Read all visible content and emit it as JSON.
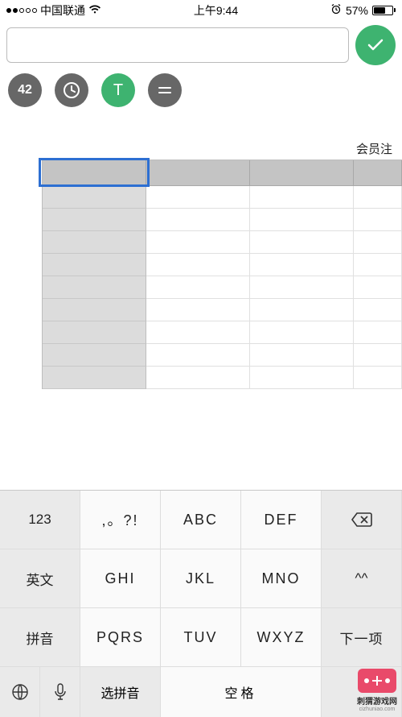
{
  "status": {
    "carrier": "中国联通",
    "time": "上午9:44",
    "battery_pct": "57%"
  },
  "input": {
    "value": "",
    "placeholder": ""
  },
  "toolbar": {
    "btn_42": "42",
    "btn_text": "T"
  },
  "sheet": {
    "label": "会员注"
  },
  "keyboard": {
    "row1": {
      "k0": "123",
      "k1": ",。?!",
      "k2": "ABC",
      "k3": "DEF"
    },
    "row2": {
      "k0": "英文",
      "k1": "GHI",
      "k2": "JKL",
      "k3": "MNO",
      "k4": "^^"
    },
    "row3": {
      "k0": "拼音",
      "k1": "PQRS",
      "k2": "TUV",
      "k3": "WXYZ"
    },
    "next": "下一项",
    "bottom": {
      "select_pinyin": "选拼音",
      "space": "空格"
    }
  },
  "watermark": {
    "title": "刺猬游戏网",
    "sub": "cizhuniao.com"
  }
}
